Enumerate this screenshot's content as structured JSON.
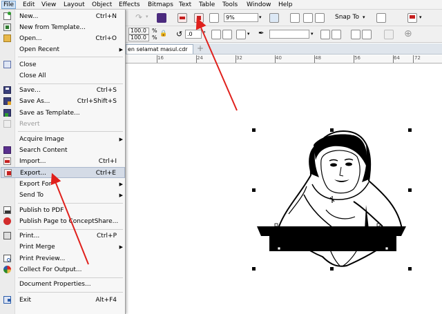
{
  "menubar": {
    "file": "File",
    "edit": "Edit",
    "view": "View",
    "layout": "Layout",
    "object": "Object",
    "effects": "Effects",
    "bitmaps": "Bitmaps",
    "text": "Text",
    "table": "Table",
    "tools": "Tools",
    "window": "Window",
    "help": "Help"
  },
  "toolbar": {
    "zoom_value": "9%",
    "snap_label": "Snap To",
    "scale_x": "100.0",
    "scale_y": "100.0",
    "percent": "%",
    "angle_value": ".0",
    "degree": "°"
  },
  "document": {
    "tab_title": "en selamat masul.cdr"
  },
  "ruler": {
    "labels": [
      "16",
      "24",
      "32",
      "40",
      "48",
      "56",
      "64",
      "72"
    ]
  },
  "file_menu": {
    "new": {
      "label": "New...",
      "shortcut": "Ctrl+N"
    },
    "new_from_template": {
      "label": "New from Template..."
    },
    "open": {
      "label": "Open...",
      "shortcut": "Ctrl+O"
    },
    "open_recent": {
      "label": "Open Recent"
    },
    "close": {
      "label": "Close"
    },
    "close_all": {
      "label": "Close All"
    },
    "save": {
      "label": "Save...",
      "shortcut": "Ctrl+S"
    },
    "save_as": {
      "label": "Save As...",
      "shortcut": "Ctrl+Shift+S"
    },
    "save_as_template": {
      "label": "Save as Template..."
    },
    "revert": {
      "label": "Revert"
    },
    "acquire_image": {
      "label": "Acquire Image"
    },
    "search_content": {
      "label": "Search Content"
    },
    "import": {
      "label": "Import...",
      "shortcut": "Ctrl+I"
    },
    "export": {
      "label": "Export...",
      "shortcut": "Ctrl+E"
    },
    "export_for": {
      "label": "Export For"
    },
    "send_to": {
      "label": "Send To"
    },
    "publish_pdf": {
      "label": "Publish to PDF"
    },
    "publish_conceptshare": {
      "label": "Publish Page to ConceptShare..."
    },
    "print": {
      "label": "Print...",
      "shortcut": "Ctrl+P"
    },
    "print_merge": {
      "label": "Print Merge"
    },
    "print_preview": {
      "label": "Print Preview..."
    },
    "collect_for_output": {
      "label": "Collect For Output..."
    },
    "document_properties": {
      "label": "Document Properties..."
    },
    "exit": {
      "label": "Exit",
      "shortcut": "Alt+F4"
    }
  },
  "colors": {
    "highlight": "#d4dbe6",
    "annotation_arrow": "#e0201c",
    "menubar_active": "#cfe3f7"
  }
}
